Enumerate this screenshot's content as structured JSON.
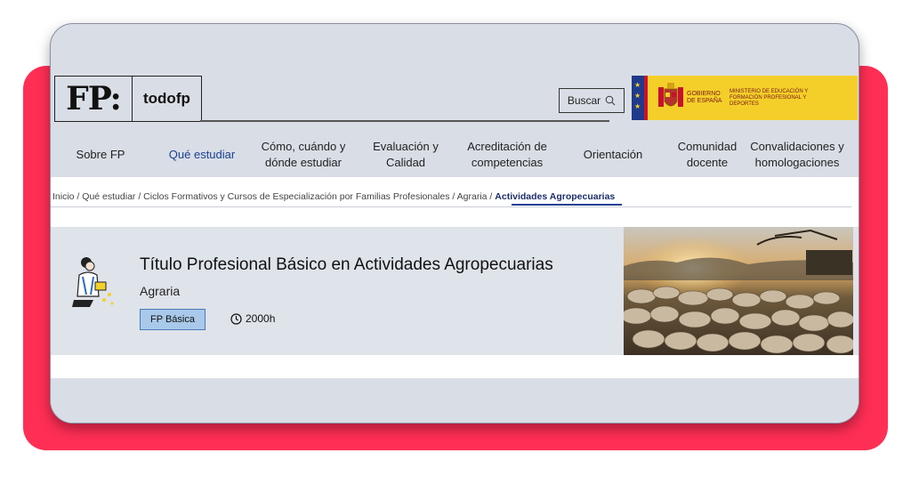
{
  "site": {
    "logo_mark": "FP:",
    "logo_name": "todofp"
  },
  "search": {
    "label": "Buscar"
  },
  "government": {
    "line1": "GOBIERNO DE ESPAÑA",
    "line2": "MINISTERIO DE EDUCACIÓN Y FORMACIÓN PROFESIONAL Y DEPORTES"
  },
  "nav": {
    "items": [
      {
        "label": "Sobre FP"
      },
      {
        "label": "Qué estudiar"
      },
      {
        "label": "Cómo, cuándo y dónde estudiar"
      },
      {
        "label": "Evaluación y Calidad"
      },
      {
        "label": "Acreditación de competencias"
      },
      {
        "label": "Orientación"
      },
      {
        "label": "Comunidad docente"
      },
      {
        "label": "Convalidaciones y homologaciones"
      }
    ],
    "active_index": 1
  },
  "breadcrumb": {
    "items": [
      "Inicio",
      "Qué estudiar",
      "Ciclos Formativos y Cursos de Especialización por Familias Profesionales",
      "Agraria"
    ],
    "current": "Actividades Agropecuarias"
  },
  "course": {
    "title": "Título Profesional Básico en Actividades Agropecuarias",
    "family": "Agraria",
    "badge": "FP Básica",
    "hours": "2000h"
  },
  "colors": {
    "accent": "#1c3f94",
    "frame_red": "#ff2e55",
    "gov_yellow": "#f4cf2a",
    "badge_blue": "#a9c9ea"
  }
}
